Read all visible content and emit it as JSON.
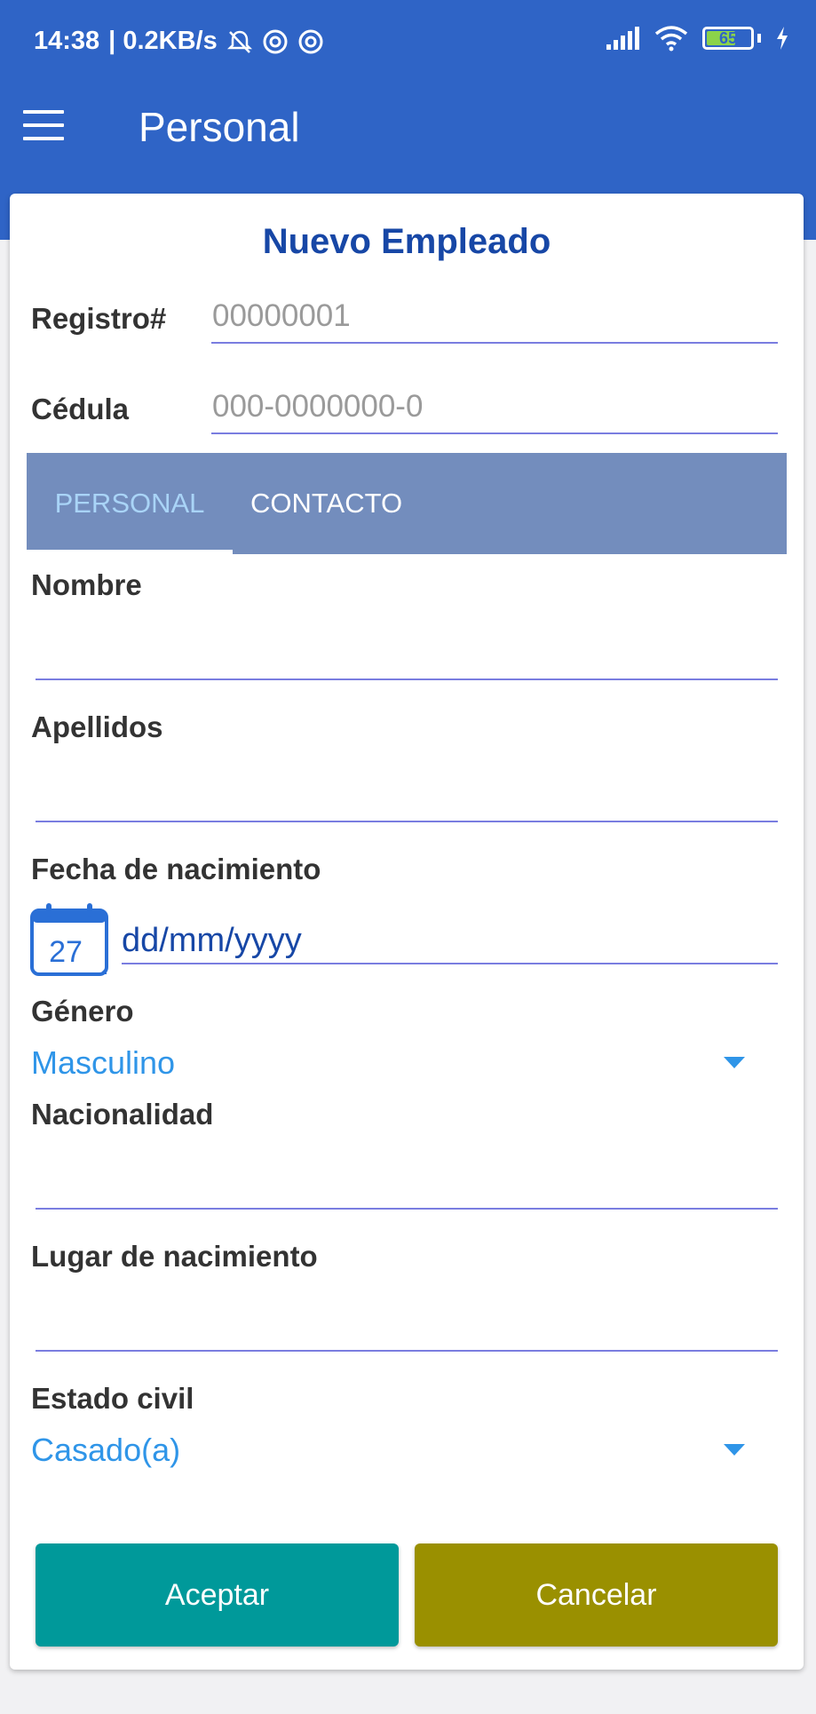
{
  "statusbar": {
    "time": "14:38",
    "network_speed": "| 0.2KB/s",
    "battery_level": "65"
  },
  "toolbar": {
    "title": "Personal"
  },
  "form": {
    "title": "Nuevo Empleado",
    "registro_label": "Registro#",
    "registro_placeholder": "00000001",
    "cedula_label": "Cédula",
    "cedula_placeholder": "000-0000000-0"
  },
  "tabs": {
    "personal": "PERSONAL",
    "contacto": "CONTACTO",
    "selected": "PERSONAL"
  },
  "personal": {
    "nombre_label": "Nombre",
    "apellidos_label": "Apellidos",
    "fecha_label": "Fecha de nacimiento",
    "calendar_day": "27",
    "fecha_placeholder": "dd/mm/yyyy",
    "genero_label": "Género",
    "genero_value": "Masculino",
    "nacionalidad_label": "Nacionalidad",
    "lugar_label": "Lugar de nacimiento",
    "estado_label": "Estado civil",
    "estado_value": "Casado(a)"
  },
  "actions": {
    "accept": "Aceptar",
    "cancel": "Cancelar"
  },
  "colors": {
    "appbar": "#2f64c6",
    "tab_bar": "#738dbd",
    "accept_button": "#00999a",
    "cancel_button": "#9a9000",
    "accent": "#2f95e8"
  },
  "icons": [
    "menu-icon",
    "calendar-icon",
    "wifi-icon",
    "signal-icon",
    "battery-icon",
    "charging-icon",
    "bell-muted-icon",
    "dropdown-arrow-icon"
  ]
}
